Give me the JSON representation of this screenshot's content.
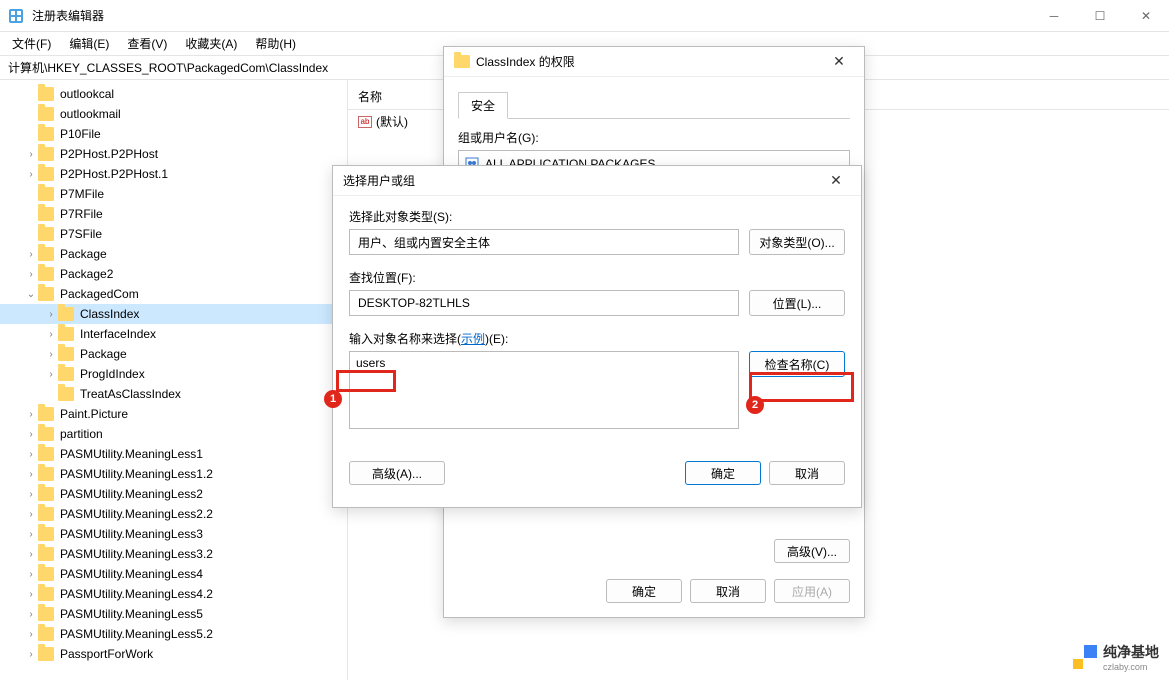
{
  "window": {
    "title": "注册表编辑器"
  },
  "menu": {
    "file": "文件(F)",
    "edit": "编辑(E)",
    "view": "查看(V)",
    "favorites": "收藏夹(A)",
    "help": "帮助(H)"
  },
  "address": "计算机\\HKEY_CLASSES_ROOT\\PackagedCom\\ClassIndex",
  "tree": [
    {
      "label": "outlookcal",
      "indent": 1,
      "arrow": ""
    },
    {
      "label": "outlookmail",
      "indent": 1,
      "arrow": ""
    },
    {
      "label": "P10File",
      "indent": 1,
      "arrow": ""
    },
    {
      "label": "P2PHost.P2PHost",
      "indent": 1,
      "arrow": ">"
    },
    {
      "label": "P2PHost.P2PHost.1",
      "indent": 1,
      "arrow": ">"
    },
    {
      "label": "P7MFile",
      "indent": 1,
      "arrow": ""
    },
    {
      "label": "P7RFile",
      "indent": 1,
      "arrow": ""
    },
    {
      "label": "P7SFile",
      "indent": 1,
      "arrow": ""
    },
    {
      "label": "Package",
      "indent": 1,
      "arrow": ">"
    },
    {
      "label": "Package2",
      "indent": 1,
      "arrow": ">"
    },
    {
      "label": "PackagedCom",
      "indent": 1,
      "arrow": "v"
    },
    {
      "label": "ClassIndex",
      "indent": 2,
      "arrow": ">",
      "selected": true
    },
    {
      "label": "InterfaceIndex",
      "indent": 2,
      "arrow": ">"
    },
    {
      "label": "Package",
      "indent": 2,
      "arrow": ">"
    },
    {
      "label": "ProgIdIndex",
      "indent": 2,
      "arrow": ">"
    },
    {
      "label": "TreatAsClassIndex",
      "indent": 2,
      "arrow": ""
    },
    {
      "label": "Paint.Picture",
      "indent": 1,
      "arrow": ">"
    },
    {
      "label": "partition",
      "indent": 1,
      "arrow": ">"
    },
    {
      "label": "PASMUtility.MeaningLess1",
      "indent": 1,
      "arrow": ">"
    },
    {
      "label": "PASMUtility.MeaningLess1.2",
      "indent": 1,
      "arrow": ">"
    },
    {
      "label": "PASMUtility.MeaningLess2",
      "indent": 1,
      "arrow": ">"
    },
    {
      "label": "PASMUtility.MeaningLess2.2",
      "indent": 1,
      "arrow": ">"
    },
    {
      "label": "PASMUtility.MeaningLess3",
      "indent": 1,
      "arrow": ">"
    },
    {
      "label": "PASMUtility.MeaningLess3.2",
      "indent": 1,
      "arrow": ">"
    },
    {
      "label": "PASMUtility.MeaningLess4",
      "indent": 1,
      "arrow": ">"
    },
    {
      "label": "PASMUtility.MeaningLess4.2",
      "indent": 1,
      "arrow": ">"
    },
    {
      "label": "PASMUtility.MeaningLess5",
      "indent": 1,
      "arrow": ">"
    },
    {
      "label": "PASMUtility.MeaningLess5.2",
      "indent": 1,
      "arrow": ">"
    },
    {
      "label": "PassportForWork",
      "indent": 1,
      "arrow": ">"
    }
  ],
  "list": {
    "col_name": "名称",
    "row_default": "(默认)"
  },
  "perm_dialog": {
    "title": "ClassIndex 的权限",
    "tab_security": "安全",
    "group_label": "组或用户名(G):",
    "group_item": "ALL APPLICATION PACKAGES",
    "advanced_btn_partial": "高级(V)...",
    "ok": "确定",
    "cancel": "取消",
    "apply": "应用(A)"
  },
  "select_dialog": {
    "title": "选择用户或组",
    "obj_type_label": "选择此对象类型(S):",
    "obj_type_value": "用户、组或内置安全主体",
    "obj_type_btn": "对象类型(O)...",
    "location_label": "查找位置(F):",
    "location_value": "DESKTOP-82TLHLS",
    "location_btn": "位置(L)...",
    "names_label_pre": "输入对象名称来选择(",
    "names_label_link": "示例",
    "names_label_post": ")(E):",
    "names_value": "users",
    "check_btn": "检查名称(C)",
    "advanced": "高级(A)...",
    "ok": "确定",
    "cancel": "取消"
  },
  "annotations": {
    "badge1": "1",
    "badge2": "2"
  },
  "watermark": {
    "name": "纯净基地",
    "url": "czlaby.com"
  }
}
